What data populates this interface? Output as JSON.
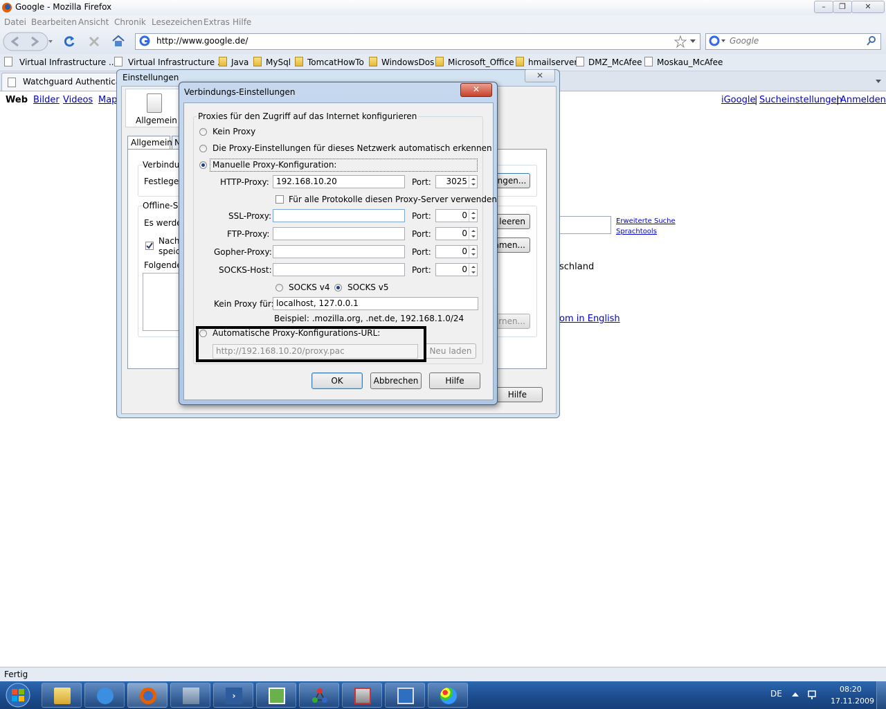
{
  "window": {
    "title": "Google - Mozilla Firefox"
  },
  "menu": [
    "Datei",
    "Bearbeiten",
    "Ansicht",
    "Chronik",
    "Lesezeichen",
    "Extras",
    "Hilfe"
  ],
  "navbar": {
    "url": "http://www.google.de/",
    "search_placeholder": "Google"
  },
  "bookmarks": [
    {
      "label": "Virtual Infrastructure ...",
      "icon": "page-icon"
    },
    {
      "label": "Virtual Infrastructure ...",
      "icon": "page-icon"
    },
    {
      "label": "Java",
      "icon": "folder-icon"
    },
    {
      "label": "MySql",
      "icon": "folder-icon"
    },
    {
      "label": "TomcatHowTo",
      "icon": "folder-icon"
    },
    {
      "label": "WindowsDos",
      "icon": "folder-icon"
    },
    {
      "label": "Microsoft_Office",
      "icon": "folder-icon"
    },
    {
      "label": "hmailserver",
      "icon": "folder-icon"
    },
    {
      "label": "DMZ_McAfee",
      "icon": "page-icon"
    },
    {
      "label": "Moskau_McAfee",
      "icon": "page-icon"
    }
  ],
  "tabs": [
    {
      "label": "Watchguard Authenticatio"
    }
  ],
  "google": {
    "nav": [
      "Web",
      "Bilder",
      "Videos",
      "Map"
    ],
    "right_links": [
      "iGoogle",
      "Sucheinstellungen",
      "Anmelden"
    ],
    "right_sep": "|",
    "advanced": [
      "Erweiterte Suche",
      "Sprachtools"
    ],
    "country": "schland",
    "english": "om in English"
  },
  "prefs": {
    "title": "Einstellungen",
    "tab_icon_label": "Allgemein",
    "subtab": "Allgemein",
    "subtab2": "N",
    "conn_group": "Verbindun",
    "conn_text": "Festlegen",
    "settings_btn": "ungen...",
    "offline_group": "Offline-Sp",
    "offline_text": "Es werder",
    "clear_btn": "t leeren",
    "notify_text_1": "Nach",
    "notify_text_2": "speic",
    "exceptions_btn": "hmen...",
    "following": "Folgende",
    "remove_btn": "rnen...",
    "help_btn": "Hilfe"
  },
  "conn": {
    "title": "Verbindungs-Einstellungen",
    "close": "✕",
    "group_label": "Proxies für den Zugriff auf das Internet konfigurieren",
    "opt_none": "Kein Proxy",
    "opt_auto_detect": "Die Proxy-Einstellungen für dieses Netzwerk automatisch erkennen",
    "opt_manual": "Manuelle Proxy-Konfiguration:",
    "selected": "manual",
    "http_label": "HTTP-Proxy:",
    "http_value": "192.168.10.20",
    "port_label": "Port:",
    "http_port": "3025",
    "all_protocols": "Für alle Protokolle diesen Proxy-Server verwenden",
    "ssl_label": "SSL-Proxy:",
    "ssl_value": "",
    "ssl_port": "0",
    "ftp_label": "FTP-Proxy:",
    "ftp_value": "",
    "ftp_port": "0",
    "gopher_label": "Gopher-Proxy:",
    "gopher_value": "",
    "gopher_port": "0",
    "socks_label": "SOCKS-Host:",
    "socks_value": "",
    "socks_port": "0",
    "socks_v4": "SOCKS v4",
    "socks_v5": "SOCKS v5",
    "no_proxy_label": "Kein Proxy für:",
    "no_proxy_value": "localhost, 127.0.0.1",
    "example": "Beispiel: .mozilla.org, .net.de, 192.168.1.0/24",
    "opt_auto_url": "Automatische Proxy-Konfigurations-URL:",
    "auto_url_value": "http://192.168.10.20/proxy.pac",
    "reload_btn": "Neu laden",
    "ok_btn": "OK",
    "cancel_btn": "Abbrechen",
    "help_btn": "Hilfe"
  },
  "status": {
    "text": "Fertig"
  },
  "taskbar": {
    "lang": "DE",
    "time": "08:20",
    "date": "17.11.2009"
  }
}
